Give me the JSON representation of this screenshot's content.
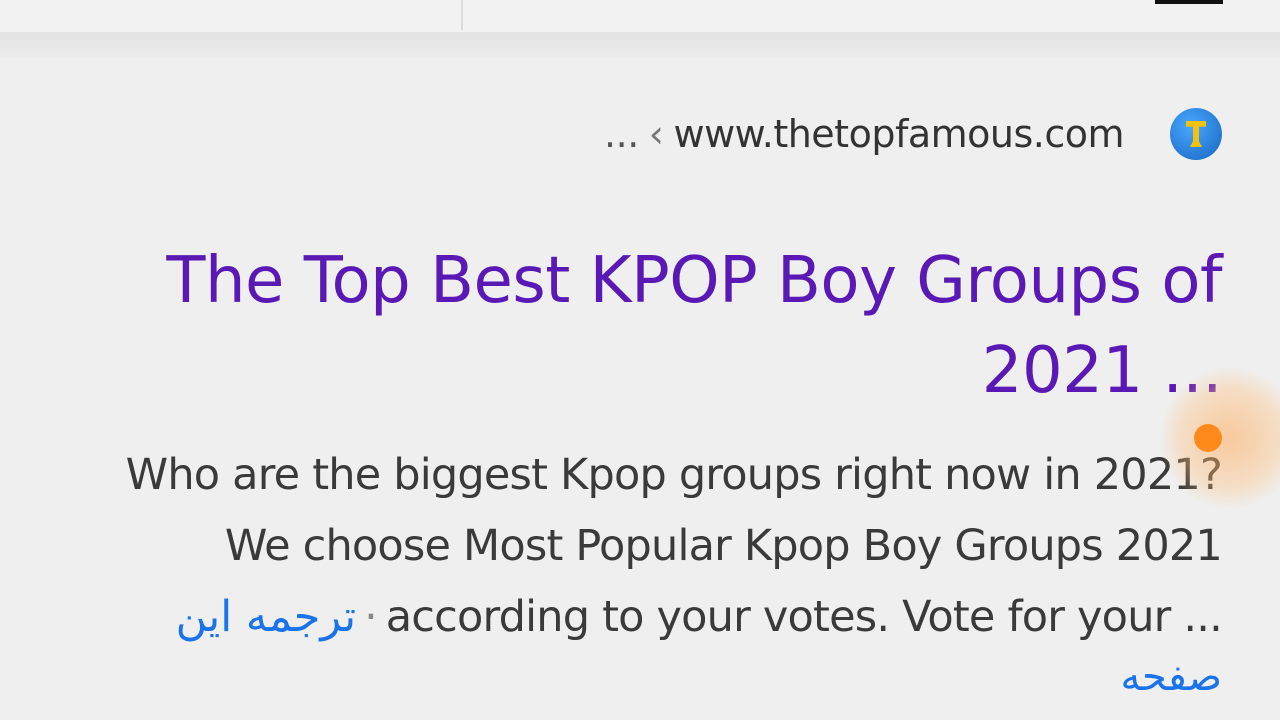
{
  "result": {
    "breadcrumb_prefix": "...",
    "breadcrumb_separator": "‹",
    "site_url": "www.thetopfamous.com",
    "favicon": "trophy-icon",
    "title_line1": "The Top Best KPOP Boy Groups of",
    "title_line2": "2021 ...",
    "snippet_line1": "Who are the biggest Kpop groups right now in 2021?",
    "snippet_line2": "We choose Most Popular Kpop Boy Groups 2021",
    "snippet_line3": "according to your votes. Vote for your ...",
    "snippet_separator": "·",
    "translate_label": "ترجمه این",
    "translate_label_2": "صفحه"
  },
  "colors": {
    "title": "#5a19b5",
    "link": "#1a73e8",
    "text": "#3a3a3a",
    "accent": "#ff8a1c"
  }
}
